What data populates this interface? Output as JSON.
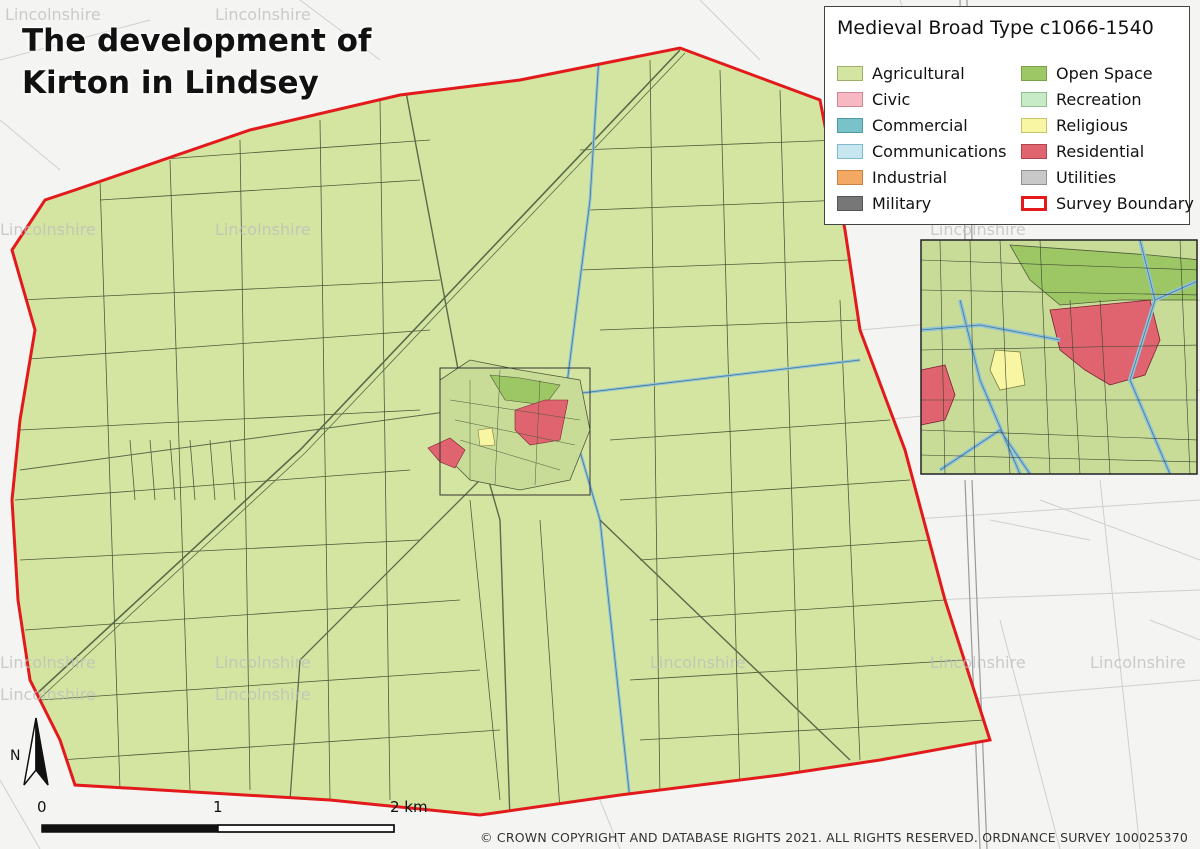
{
  "title_line1": "The development of",
  "title_line2": "Kirton in Lindsey",
  "legend": {
    "title": "Medieval Broad Type c1066-1540",
    "items": [
      {
        "label": "Agricultural",
        "color": "#d4e5a2",
        "border": "#9cb06a"
      },
      {
        "label": "Civic",
        "color": "#f7b8c4",
        "border": "#c98a96"
      },
      {
        "label": "Commercial",
        "color": "#79c2c9",
        "border": "#4f9aa0"
      },
      {
        "label": "Communications",
        "color": "#c7e6f0",
        "border": "#7fb9cc"
      },
      {
        "label": "Industrial",
        "color": "#f3a863",
        "border": "#c98040"
      },
      {
        "label": "Military",
        "color": "#777777",
        "border": "#555555"
      },
      {
        "label": "Open Space",
        "color": "#9dc765",
        "border": "#7aa048"
      },
      {
        "label": "Recreation",
        "color": "#c6ebc6",
        "border": "#8fbf8f"
      },
      {
        "label": "Religious",
        "color": "#f8f6a3",
        "border": "#c6c46e"
      },
      {
        "label": "Residential",
        "color": "#e06470",
        "border": "#b24450"
      },
      {
        "label": "Utilities",
        "color": "#c8c8c8",
        "border": "#8f8f8f"
      },
      {
        "label": "Survey Boundary",
        "color": "#ffffff",
        "border": "#e31a1c"
      }
    ]
  },
  "scale": {
    "zero": "0",
    "one": "1",
    "two": "2 km"
  },
  "north_label": "N",
  "copyright": "© CROWN COPYRIGHT AND DATABASE RIGHTS 2021. ALL RIGHTS RESERVED. ORDNANCE SURVEY 100025370",
  "watermark": "Lincolnshire",
  "colors": {
    "agricultural": "#d4e5a2",
    "residential": "#e06470",
    "open_space": "#9dc765",
    "religious": "#f8f6a3",
    "roads": "#8fc3dc",
    "boundary": "#e31a1c",
    "background": "#f4f4f2"
  }
}
